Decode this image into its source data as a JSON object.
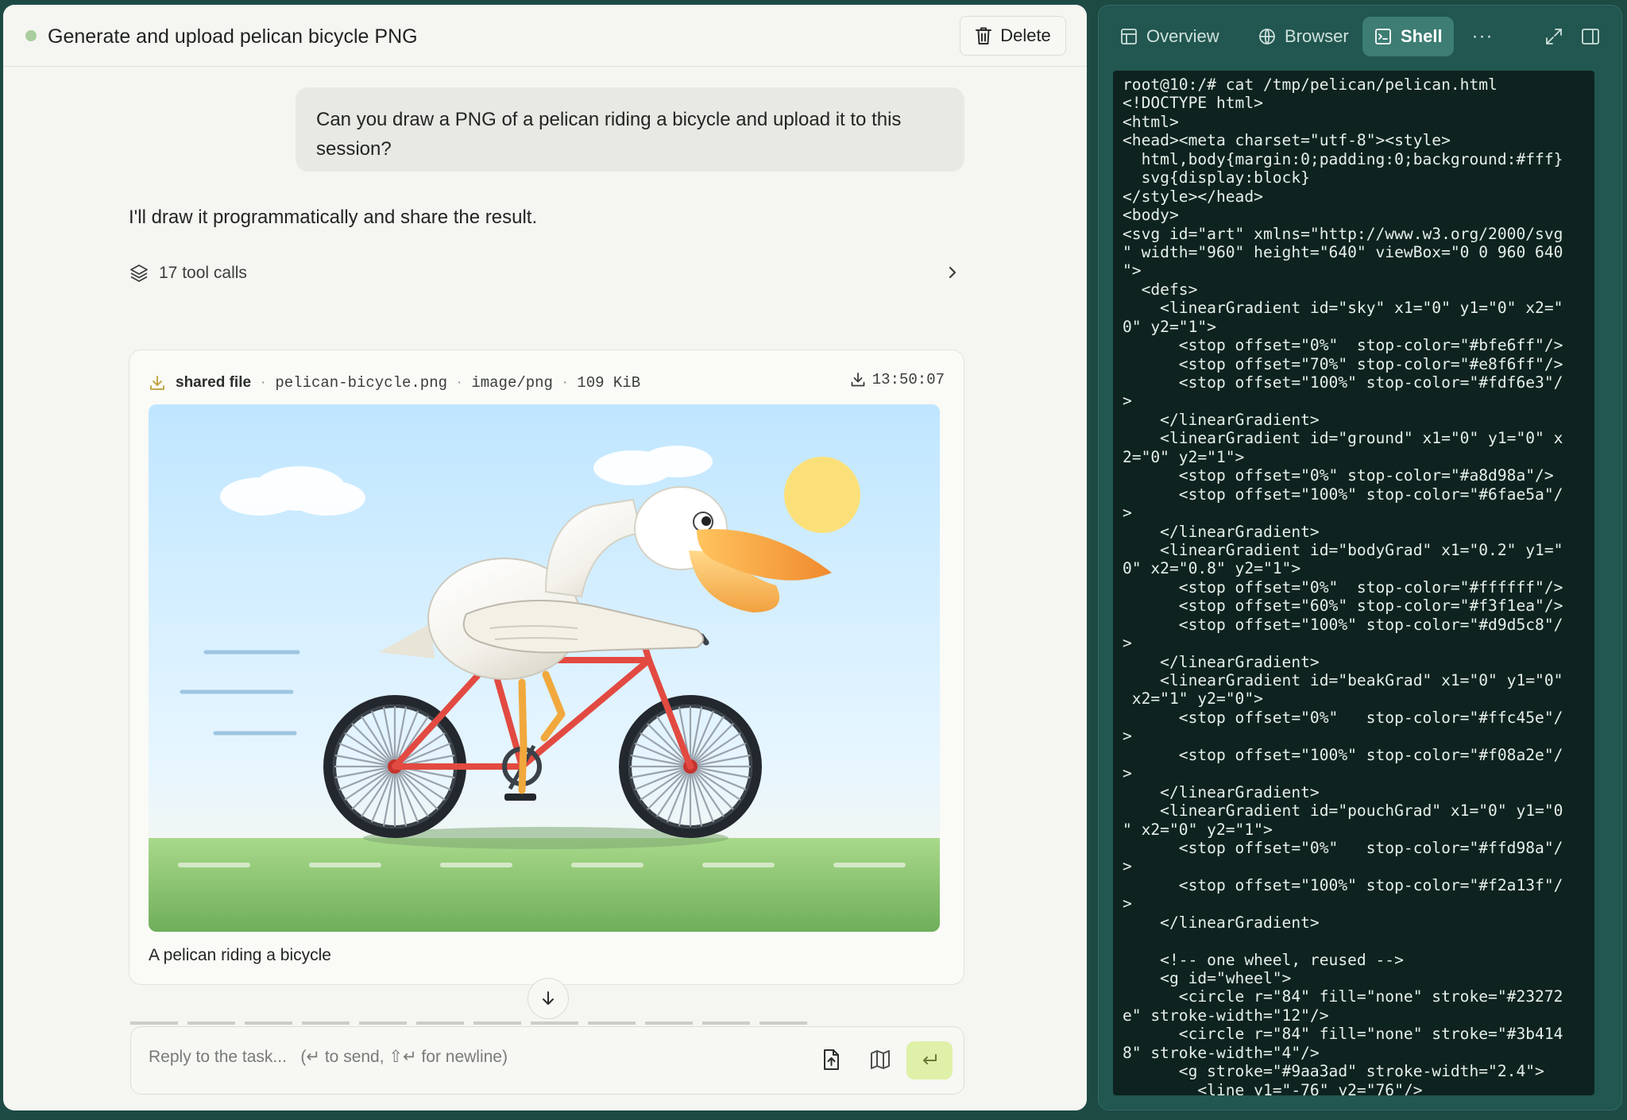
{
  "chat": {
    "title": "Generate and upload pelican bicycle PNG",
    "delete_label": "Delete",
    "user_message": "Can you draw a PNG of a pelican riding a bicycle and upload it to this session?",
    "assistant_message": "I'll draw it programmatically and share the result.",
    "tool_calls_label": "17 tool calls",
    "file": {
      "kind": "shared file",
      "name": "pelican-bicycle.png",
      "mime": "image/png",
      "size": "109 KiB",
      "time": "13:50:07",
      "caption": "A pelican riding a bicycle"
    },
    "reply_placeholder": "Reply to the task...   (↵ to send, ⇧↵ for newline)"
  },
  "shell": {
    "tabs": [
      "Overview",
      "Browser",
      "Shell"
    ],
    "active_tab": "Shell",
    "more_label": "···",
    "lines": [
      "root@10:/# cat /tmp/pelican/pelican.html",
      "<!DOCTYPE html>",
      "<html>",
      "<head><meta charset=\"utf-8\"><style>",
      "  html,body{margin:0;padding:0;background:#fff}",
      "  svg{display:block}",
      "</style></head>",
      "<body>",
      "<svg id=\"art\" xmlns=\"http://www.w3.org/2000/svg",
      "\" width=\"960\" height=\"640\" viewBox=\"0 0 960 640",
      "\">",
      "  <defs>",
      "    <linearGradient id=\"sky\" x1=\"0\" y1=\"0\" x2=\"",
      "0\" y2=\"1\">",
      "      <stop offset=\"0%\"  stop-color=\"#bfe6ff\"/>",
      "      <stop offset=\"70%\" stop-color=\"#e8f6ff\"/>",
      "      <stop offset=\"100%\" stop-color=\"#fdf6e3\"/",
      ">",
      "    </linearGradient>",
      "    <linearGradient id=\"ground\" x1=\"0\" y1=\"0\" x",
      "2=\"0\" y2=\"1\">",
      "      <stop offset=\"0%\" stop-color=\"#a8d98a\"/>",
      "      <stop offset=\"100%\" stop-color=\"#6fae5a\"/",
      ">",
      "    </linearGradient>",
      "    <linearGradient id=\"bodyGrad\" x1=\"0.2\" y1=\"",
      "0\" x2=\"0.8\" y2=\"1\">",
      "      <stop offset=\"0%\"  stop-color=\"#ffffff\"/>",
      "      <stop offset=\"60%\" stop-color=\"#f3f1ea\"/>",
      "      <stop offset=\"100%\" stop-color=\"#d9d5c8\"/",
      ">",
      "    </linearGradient>",
      "    <linearGradient id=\"beakGrad\" x1=\"0\" y1=\"0\"",
      " x2=\"1\" y2=\"0\">",
      "      <stop offset=\"0%\"   stop-color=\"#ffc45e\"/",
      ">",
      "      <stop offset=\"100%\" stop-color=\"#f08a2e\"/",
      ">",
      "    </linearGradient>",
      "    <linearGradient id=\"pouchGrad\" x1=\"0\" y1=\"0",
      "\" x2=\"0\" y2=\"1\">",
      "      <stop offset=\"0%\"   stop-color=\"#ffd98a\"/",
      ">",
      "      <stop offset=\"100%\" stop-color=\"#f2a13f\"/",
      ">",
      "    </linearGradient>",
      "",
      "    <!-- one wheel, reused -->",
      "    <g id=\"wheel\">",
      "      <circle r=\"84\" fill=\"none\" stroke=\"#23272",
      "e\" stroke-width=\"12\"/>",
      "      <circle r=\"84\" fill=\"none\" stroke=\"#3b414",
      "8\" stroke-width=\"4\"/>",
      "      <g stroke=\"#9aa3ad\" stroke-width=\"2.4\">",
      "        <line y1=\"-76\" y2=\"76\"/>"
    ]
  },
  "colors": {
    "accent_green": "#a9cd9f",
    "send_button": "#dff0a8",
    "shell_bg": "#225650",
    "terminal_bg": "#0e2320"
  }
}
